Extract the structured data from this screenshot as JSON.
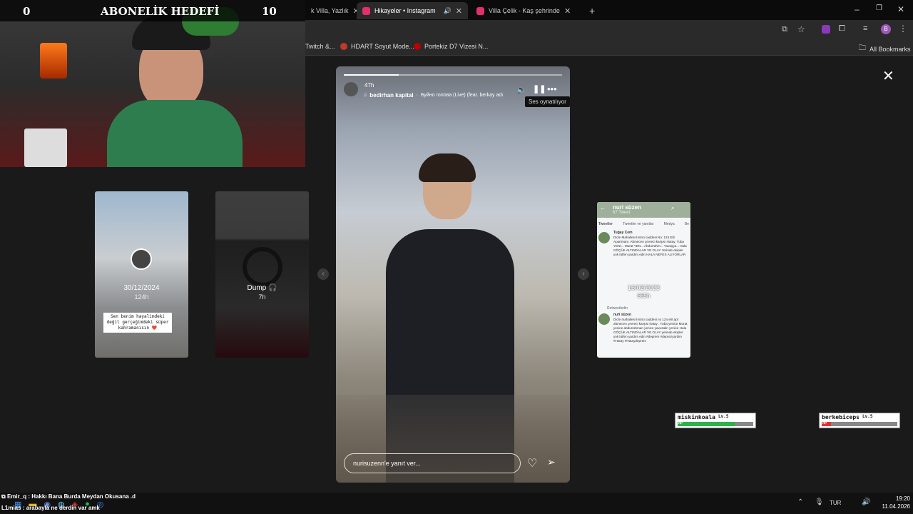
{
  "tabs": [
    {
      "label": "k Villa, Yazlık",
      "active": false
    },
    {
      "label": "Hikayeler • Instagram",
      "active": true
    },
    {
      "label": "Villa Çelik - Kaş şehrinde Kiralık",
      "active": false
    }
  ],
  "new_tab": "+",
  "bookmarks": [
    {
      "label": "Twitch &..."
    },
    {
      "label": "HDART Soyut Mode..."
    },
    {
      "label": "Portekiz D7 Vizesi N..."
    }
  ],
  "all_bookmarks": "All Bookmarks",
  "overlay": {
    "goal_left": "0",
    "goal_title": "ABONELİK HEDEFİ",
    "goal_right": "10"
  },
  "thumbs": [
    {
      "date": "30/12/2024",
      "age": "124h",
      "caption": "Sen benim hayalimdeki değil gerçeğimdeki süper kahramanısın ❤️"
    },
    {
      "title": "Dump 🎧",
      "age": "7h"
    }
  ],
  "story": {
    "time": "47h",
    "username": "bedirhan kapital",
    "music": "Буйно голова (Live) (feat. berkay adı",
    "tooltip": "Ses oynatılıyor",
    "reply_placeholder": "nurisuzenn'e yanıt ver...",
    "progress_fraction": 0.25
  },
  "twitter": {
    "name": "nuri süzen",
    "tweets": "67 Tweet",
    "tabs": [
      "Tweetler",
      "Tweetler ve yanıtlar",
      "Medya",
      "Be"
    ],
    "date_overlay": "16/02/2023",
    "age_overlay": "665h",
    "tweet1_author": "Tuğay Cem",
    "tweet1_text": "Dicle Mahallesi İnönü caddesi No: 124 Elit Apartmanı. Altınecen çevreci karşısı Hatay. Tuba YENİ... Murat YEN... Abdurrahm... Yavaşça... Hala GÖÇÜK ALTINDALAR VE OLAY Yerinde ekipler yok lütfen yardım edin HALA NEFES ALIYORLAR",
    "retweet_label": "Retweetledin",
    "tweet2_author": "nuri süzen",
    "tweet2_text": "Dicle mahallesi İnönü caddesi no 124 elit apt altınecen çevreci karşısı hatay . Tuba yenice Murat yenice abdurrahman yenice yavuzalin yenice Hala GÖÇÜK ALTINDALAR VE OLAY yerinde ekipler yok lütfen yardım edin #deprem #deprezyardim #Hatay #Hataydeprem"
  },
  "hud": [
    {
      "name": "miskinkoala",
      "level": "Lv.5",
      "hp_label": "HP",
      "hp": 0.75
    },
    {
      "name": "berkebiceps",
      "level": "Lv.5",
      "hp_label": "HP",
      "hp": 0.12
    }
  ],
  "chat": [
    {
      "user": "Emir_q",
      "message": "Hakkı Bana Burda Meydan Okusana .d"
    },
    {
      "user": "L1mias",
      "message": "arabayla ne derdin var amk"
    }
  ],
  "taskbar": {
    "time": "19:20",
    "date": "11.04.2026",
    "lang": "TUR"
  },
  "colors": {
    "instagram": "#e1306c",
    "hp_green": "#2db24a",
    "hp_red": "#d33"
  }
}
